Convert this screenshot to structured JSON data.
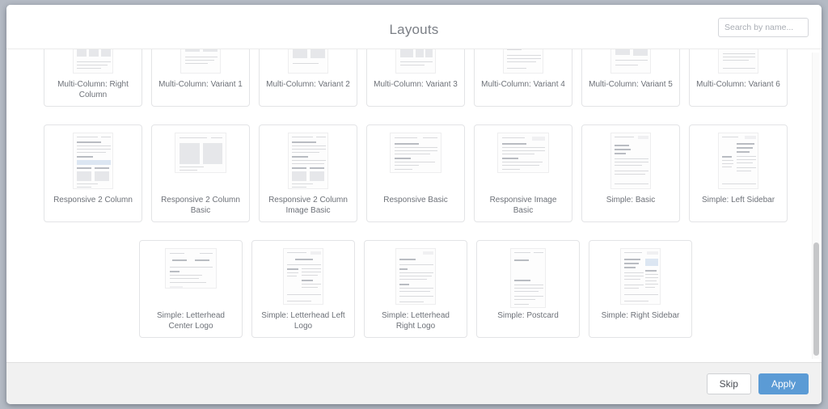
{
  "header": {
    "title": "Layouts",
    "search": {
      "placeholder": "Search by name...",
      "value": ""
    }
  },
  "colors": {
    "accent": "#5b9bd5",
    "page_background": "#b4bac4",
    "dialog_background": "#ffffff",
    "footer_background": "#f1f1f1",
    "card_border": "#e3e4e6",
    "label_text": "#6d7178",
    "title_text": "#7b7f86"
  },
  "grid": {
    "rows": [
      {
        "row_name": "multi-column-row",
        "centered": false,
        "cards": [
          {
            "label": "Multi-Column: Right Column",
            "thumb": "portrait",
            "style": "three-col-right"
          },
          {
            "label": "Multi-Column: Variant 1",
            "thumb": "portrait",
            "style": "two-col-blocks"
          },
          {
            "label": "Multi-Column: Variant 2",
            "thumb": "portrait",
            "style": "three-col-even"
          },
          {
            "label": "Multi-Column: Variant 3",
            "thumb": "portrait",
            "style": "text-plus-table"
          },
          {
            "label": "Multi-Column: Variant 4",
            "thumb": "portrait",
            "style": "dense-two-col"
          },
          {
            "label": "Multi-Column: Variant 5",
            "thumb": "portrait",
            "style": "narrow-two-col"
          },
          {
            "label": "Multi-Column: Variant 6",
            "thumb": "portrait",
            "style": "header-band-col"
          }
        ]
      },
      {
        "row_name": "responsive-and-simple-row",
        "centered": false,
        "cards": [
          {
            "label": "Responsive 2 Column",
            "thumb": "portrait",
            "style": "responsive-two-col"
          },
          {
            "label": "Responsive 2 Column Basic",
            "thumb": "wide",
            "style": "wide-two-col"
          },
          {
            "label": "Responsive 2 Column Image Basic",
            "thumb": "portrait",
            "style": "responsive-two-col-image"
          },
          {
            "label": "Responsive Basic",
            "thumb": "wide",
            "style": "wide-single-col"
          },
          {
            "label": "Responsive Image Basic",
            "thumb": "wide",
            "style": "wide-image-col"
          },
          {
            "label": "Simple: Basic",
            "thumb": "portrait",
            "style": "simple-basic"
          },
          {
            "label": "Simple: Left Sidebar",
            "thumb": "portrait",
            "style": "left-sidebar"
          }
        ]
      },
      {
        "row_name": "simple-letterhead-row",
        "centered": true,
        "cards": [
          {
            "label": "Simple: Letterhead Center Logo",
            "thumb": "wide",
            "style": "letterhead-center"
          },
          {
            "label": "Simple: Letterhead Left Logo",
            "thumb": "portrait",
            "style": "letterhead-left"
          },
          {
            "label": "Simple: Letterhead Right Logo",
            "thumb": "portrait",
            "style": "letterhead-right"
          },
          {
            "label": "Simple: Postcard",
            "thumb": "tall",
            "style": "postcard"
          },
          {
            "label": "Simple: Right Sidebar",
            "thumb": "portrait",
            "style": "right-sidebar"
          }
        ]
      }
    ]
  },
  "scrollbar": {
    "orientation": "vertical",
    "thumb_top_percent": 62,
    "thumb_height_percent": 37
  },
  "footer": {
    "skip_label": "Skip",
    "apply_label": "Apply"
  }
}
